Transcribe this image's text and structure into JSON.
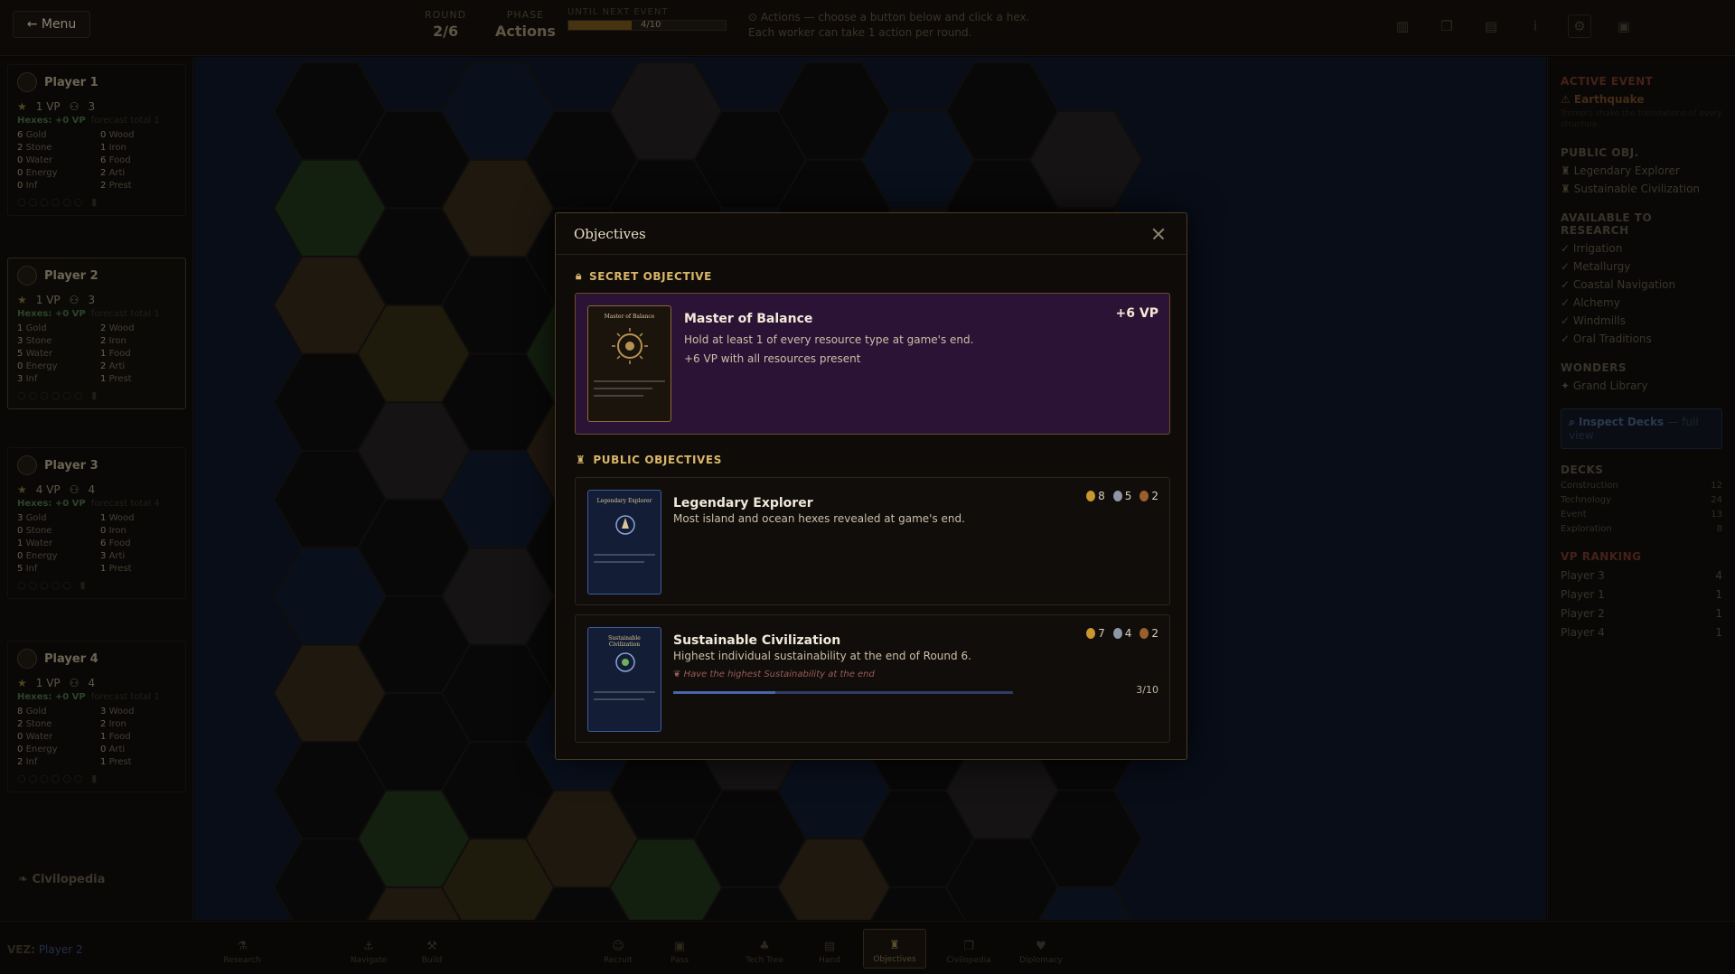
{
  "topbar": {
    "menu_label": "← Menu",
    "round_label": "ROUND",
    "round_value": "2/6",
    "phase_label": "PHASE",
    "phase_value": "Actions",
    "event_label": "UNTIL NEXT EVENT",
    "event_progress_text": "4/10",
    "event_progress_fraction": 0.4,
    "instructions": "⊙ Actions — choose a button below and click a hex. Each worker can take 1 action per round."
  },
  "players": [
    {
      "name": "Player 1",
      "vp": "1 VP",
      "workers": "3",
      "hexes": "Hexes: +0 VP",
      "forecast": "forecast total 1",
      "res": [
        [
          "6",
          "Gold"
        ],
        [
          "0",
          "Wood"
        ],
        [
          "2",
          "Stone"
        ],
        [
          "1",
          "Iron"
        ],
        [
          "0",
          "Water"
        ],
        [
          "6",
          "Food"
        ],
        [
          "0",
          "Energy"
        ],
        [
          "2",
          "Arti"
        ],
        [
          "0",
          "Inf"
        ],
        [
          "2",
          "Prest"
        ]
      ]
    },
    {
      "name": "Player 2",
      "vp": "1 VP",
      "workers": "3",
      "hexes": "Hexes: +0 VP",
      "forecast": "forecast total 1",
      "res": [
        [
          "1",
          "Gold"
        ],
        [
          "2",
          "Wood"
        ],
        [
          "3",
          "Stone"
        ],
        [
          "2",
          "Iron"
        ],
        [
          "5",
          "Water"
        ],
        [
          "1",
          "Food"
        ],
        [
          "0",
          "Energy"
        ],
        [
          "2",
          "Arti"
        ],
        [
          "3",
          "Inf"
        ],
        [
          "1",
          "Prest"
        ]
      ]
    },
    {
      "name": "Player 3",
      "vp": "4 VP",
      "workers": "4",
      "hexes": "Hexes: +0 VP",
      "forecast": "forecast total 4",
      "res": [
        [
          "3",
          "Gold"
        ],
        [
          "1",
          "Wood"
        ],
        [
          "0",
          "Stone"
        ],
        [
          "0",
          "Iron"
        ],
        [
          "1",
          "Water"
        ],
        [
          "6",
          "Food"
        ],
        [
          "0",
          "Energy"
        ],
        [
          "3",
          "Arti"
        ],
        [
          "5",
          "Inf"
        ],
        [
          "1",
          "Prest"
        ]
      ]
    },
    {
      "name": "Player 4",
      "vp": "1 VP",
      "workers": "4",
      "hexes": "Hexes: +0 VP",
      "forecast": "forecast total 1",
      "res": [
        [
          "8",
          "Gold"
        ],
        [
          "3",
          "Wood"
        ],
        [
          "2",
          "Stone"
        ],
        [
          "2",
          "Iron"
        ],
        [
          "0",
          "Water"
        ],
        [
          "1",
          "Food"
        ],
        [
          "0",
          "Energy"
        ],
        [
          "0",
          "Arti"
        ],
        [
          "2",
          "Inf"
        ],
        [
          "1",
          "Prest"
        ]
      ]
    }
  ],
  "left": {
    "civilopedia": "Civilopedia"
  },
  "right": {
    "event_head": "ACTIVE EVENT",
    "event_name": "⚠ Earthquake",
    "event_desc": "Tremors shake the foundations of every structure.",
    "public_head": "PUBLIC OBJ.",
    "public_items": [
      "Legendary Explorer",
      "Sustainable Civilization"
    ],
    "research_head": "AVAILABLE TO RESEARCH",
    "research_items": [
      "✓ Irrigation",
      "✓ Metallurgy",
      "✓ Coastal Navigation",
      "✓ Alchemy",
      "✓ Windmills",
      "✓ Oral Traditions"
    ],
    "wonders_head": "WONDERS",
    "wonder_item": "✦ Grand Library",
    "inspect_label": "Inspect Decks",
    "inspect_sub": "— full view",
    "decks_head": "DECKS",
    "decks": [
      [
        "Construction",
        "12"
      ],
      [
        "Technology",
        "24"
      ],
      [
        "Event",
        "13"
      ],
      [
        "Exploration",
        "8"
      ]
    ],
    "vp_head": "VP RANKING",
    "vp_rank": [
      [
        "Player 3",
        "4"
      ],
      [
        "Player 1",
        "1"
      ],
      [
        "Player 2",
        "1"
      ],
      [
        "Player 4",
        "1"
      ]
    ]
  },
  "bottom": {
    "turn_prefix": "VEZ:",
    "turn_player": "Player 2",
    "buttons": [
      "Research",
      "Navigate",
      "Build",
      "Recruit",
      "Pass",
      "Tech Tree",
      "Hand",
      "Objectives",
      "Civilopedia",
      "Diplomacy"
    ]
  },
  "modal": {
    "title": "Objectives",
    "secret_head": "SECRET OBJECTIVE",
    "secret": {
      "title": "Master of Balance",
      "vp": "+6 VP",
      "desc": "Hold at least 1 of every resource type at game's end.",
      "bonus": "+6 VP with all resources present",
      "thumb_title": "Master of Balance"
    },
    "public_head": "PUBLIC OBJECTIVES",
    "public": [
      {
        "title": "Legendary Explorer",
        "desc": "Most island and ocean hexes revealed at game's end.",
        "gold": "8",
        "silver": "5",
        "bronze": "2",
        "thumb_title": "Legendary Explorer"
      },
      {
        "title": "Sustainable Civilization",
        "desc": "Highest individual sustainability at the end of Round 6.",
        "hint": "Have the highest Sustainability at the end",
        "gold": "7",
        "silver": "4",
        "bronze": "2",
        "progress_text": "3/10",
        "progress_fraction": 0.3,
        "thumb_title": "Sustainable Civilization"
      }
    ]
  }
}
